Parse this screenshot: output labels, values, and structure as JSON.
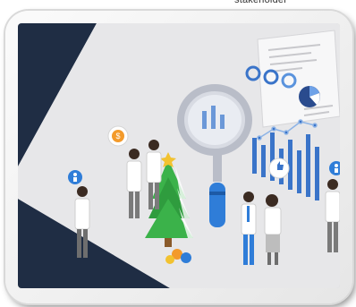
{
  "caption": {
    "text": "stakeholder"
  },
  "illustration": {
    "colors": {
      "navy": "#1f2d44",
      "floor": "#e2e2e4",
      "accent_blue": "#2f7dd8",
      "chart_blue": "#3a74c9",
      "tree_green": "#3bb24a",
      "coin_orange": "#f39a2b"
    },
    "icons": [
      "dollar-icon",
      "thumbs-up-icon",
      "person-icon",
      "star-icon",
      "magnifier-icon",
      "pie-chart-icon",
      "bar-chart-icon"
    ]
  }
}
